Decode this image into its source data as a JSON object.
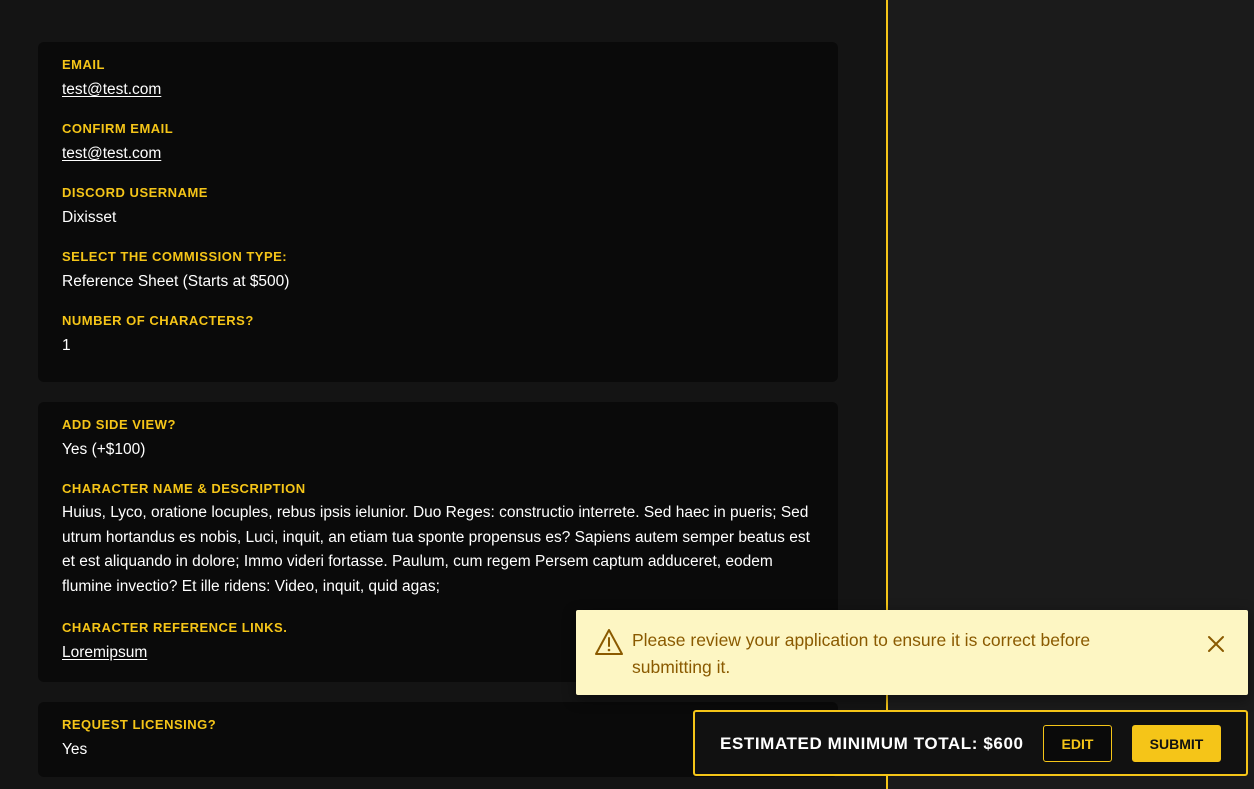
{
  "sections": [
    {
      "fields": [
        {
          "label": "EMAIL",
          "value": "test@test.com"
        },
        {
          "label": "CONFIRM EMAIL",
          "value": "test@test.com"
        },
        {
          "label": "DISCORD USERNAME",
          "value": "Dixisset"
        },
        {
          "label": "SELECT THE COMMISSION TYPE:",
          "value": "Reference Sheet (Starts at $500)"
        },
        {
          "label": "NUMBER OF CHARACTERS?",
          "value": "1"
        }
      ]
    },
    {
      "fields": [
        {
          "label": "ADD SIDE VIEW?",
          "value": "Yes (+$100)"
        },
        {
          "label": "CHARACTER NAME & DESCRIPTION",
          "value": "Huius, Lyco, oratione locuples, rebus ipsis ielunior. Duo Reges: constructio interrete. Sed haec in pueris; Sed utrum hortandus es nobis, Luci, inquit, an etiam tua sponte propensus es? Sapiens autem semper beatus est et est aliquando in dolore; Immo videri fortasse. Paulum, cum regem Persem captum adduceret, eodem flumine invectio? Et ille ridens: Video, inquit, quid agas;"
        },
        {
          "label": "CHARACTER REFERENCE LINKS.",
          "value": "Loremipsum"
        }
      ]
    },
    {
      "fields": [
        {
          "label": "REQUEST LICENSING?",
          "value": "Yes"
        }
      ]
    }
  ],
  "toast": {
    "message": "Please review your application to ensure it is correct before submitting it.",
    "icon": "warning-triangle-icon",
    "close_icon": "close-icon"
  },
  "footer": {
    "total_label": "ESTIMATED MINIMUM TOTAL: $600",
    "edit_label": "EDIT",
    "submit_label": "SUBMIT"
  },
  "colors": {
    "accent": "#f5c518",
    "toast_bg": "#fdf6c3",
    "toast_text": "#8a5a00",
    "card_bg": "#0a0a0a",
    "page_bg": "#141414"
  }
}
